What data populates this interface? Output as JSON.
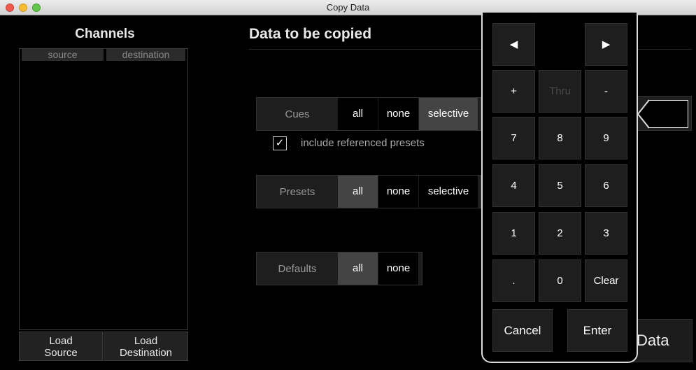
{
  "window": {
    "title": "Copy Data"
  },
  "channels": {
    "heading": "Channels",
    "columns": [
      "source",
      "destination"
    ],
    "load_source": [
      "Load",
      "Source"
    ],
    "load_destination": [
      "Load",
      "Destination"
    ]
  },
  "data_panel": {
    "heading": "Data to be copied",
    "cues": {
      "label": "Cues",
      "options": [
        "all",
        "none",
        "selective"
      ],
      "selected": "selective"
    },
    "include_referenced": {
      "checked": true,
      "check_glyph": "✓",
      "label": "include referenced presets"
    },
    "presets": {
      "label": "Presets",
      "options": [
        "all",
        "none",
        "selective"
      ],
      "selected": "all"
    },
    "defaults": {
      "label": "Defaults",
      "options": [
        "all",
        "none"
      ],
      "selected": "all"
    },
    "copy_button_partial": "Data"
  },
  "keypad": {
    "nav_left": "◀",
    "nav_right": "▶",
    "plus": "+",
    "thru": "Thru",
    "minus": "-",
    "digits": [
      "7",
      "8",
      "9",
      "4",
      "5",
      "6",
      "1",
      "2",
      "3"
    ],
    "dot": ".",
    "zero": "0",
    "clear": "Clear",
    "cancel": "Cancel",
    "enter": "Enter"
  }
}
